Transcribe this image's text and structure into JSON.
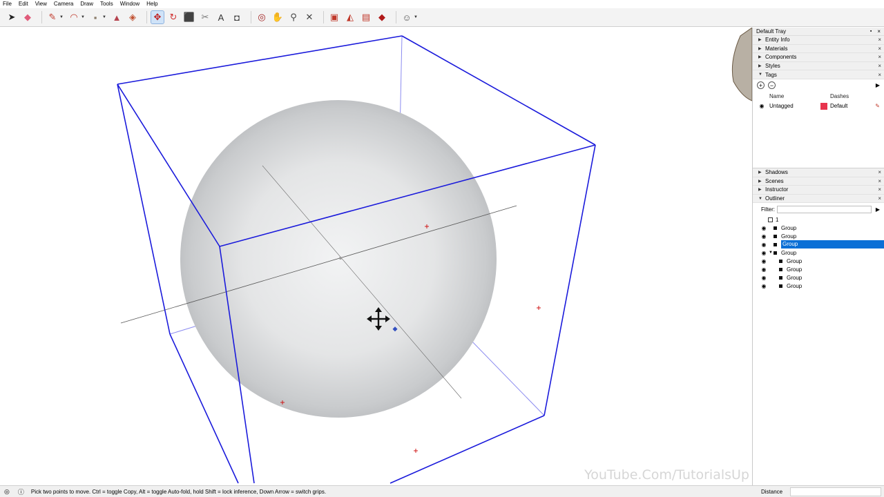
{
  "menu": [
    "File",
    "Edit",
    "View",
    "Camera",
    "Draw",
    "Tools",
    "Window",
    "Help"
  ],
  "toolbar": {
    "tools": [
      {
        "name": "select-tool-button",
        "icon": "arrow-icon"
      },
      {
        "name": "eraser-tool-button",
        "icon": "eraser-icon"
      },
      {
        "name": "line-tool-button",
        "icon": "pencil-icon",
        "dropdown": true
      },
      {
        "name": "arc-tool-button",
        "icon": "arc-icon",
        "dropdown": true
      },
      {
        "name": "shapes-tool-button",
        "icon": "rectangle-icon",
        "dropdown": true
      },
      {
        "name": "push-pull-tool-button",
        "icon": "push-pull-icon"
      },
      {
        "name": "offset-tool-button",
        "icon": "offset-icon"
      },
      {
        "name": "move-tool-button",
        "icon": "move-icon",
        "active": true
      },
      {
        "name": "rotate-tool-button",
        "icon": "rotate-icon"
      },
      {
        "name": "scale-tool-button",
        "icon": "scale-icon"
      },
      {
        "name": "tape-measure-tool-button",
        "icon": "tape-measure-icon"
      },
      {
        "name": "text-tool-button",
        "icon": "text-icon"
      },
      {
        "name": "paint-bucket-tool-button",
        "icon": "paint-bucket-icon"
      },
      {
        "name": "orbit-tool-button",
        "icon": "orbit-icon"
      },
      {
        "name": "pan-tool-button",
        "icon": "pan-icon"
      },
      {
        "name": "zoom-tool-button",
        "icon": "zoom-icon"
      },
      {
        "name": "zoom-extents-tool-button",
        "icon": "zoom-extents-icon"
      },
      {
        "name": "3d-warehouse-button",
        "icon": "warehouse-icon"
      },
      {
        "name": "extension-warehouse-button",
        "icon": "extension-icon"
      },
      {
        "name": "send-to-layout-button",
        "icon": "layout-icon"
      },
      {
        "name": "extension-manager-button",
        "icon": "ruby-icon"
      },
      {
        "name": "user-account-button",
        "icon": "user-icon",
        "dropdown": true
      }
    ]
  },
  "tray": {
    "title": "Default Tray",
    "panels_top": [
      {
        "label": "Entity Info",
        "expanded": false
      },
      {
        "label": "Materials",
        "expanded": false
      },
      {
        "label": "Components",
        "expanded": false
      },
      {
        "label": "Styles",
        "expanded": false
      },
      {
        "label": "Tags",
        "expanded": true
      }
    ],
    "tags": {
      "col_name": "Name",
      "col_dashes": "Dashes",
      "rows": [
        {
          "name": "Untagged",
          "color": "#e8344d",
          "dashes": "Default"
        }
      ]
    },
    "panels_bottom": [
      {
        "label": "Shadows",
        "expanded": false
      },
      {
        "label": "Scenes",
        "expanded": false
      },
      {
        "label": "Instructor",
        "expanded": false
      },
      {
        "label": "Outliner",
        "expanded": true
      }
    ],
    "outliner": {
      "filter_label": "Filter:",
      "filter_value": "",
      "root": "1",
      "rows": [
        {
          "label": "Group",
          "depth": 1,
          "selected": false,
          "expanded": null
        },
        {
          "label": "Group",
          "depth": 1,
          "selected": false,
          "expanded": null
        },
        {
          "label": "Group",
          "depth": 1,
          "selected": true,
          "expanded": null
        },
        {
          "label": "Group",
          "depth": 1,
          "selected": false,
          "expanded": true
        },
        {
          "label": "Group",
          "depth": 2,
          "selected": false,
          "expanded": null
        },
        {
          "label": "Group",
          "depth": 2,
          "selected": false,
          "expanded": null
        },
        {
          "label": "Group",
          "depth": 2,
          "selected": false,
          "expanded": null
        },
        {
          "label": "Group",
          "depth": 2,
          "selected": false,
          "expanded": null
        }
      ]
    }
  },
  "viewport": {
    "watermark": "YouTube.Com/TutorialsUp",
    "box_color": "#1a1adb",
    "sphere_color": "#d9dbdd"
  },
  "status": {
    "message": "Pick two points to move.  Ctrl = toggle Copy, Alt = toggle Auto-fold, hold Shift = lock inference, Down Arrow = switch grips.",
    "measure_label": "Distance",
    "measure_value": ""
  }
}
